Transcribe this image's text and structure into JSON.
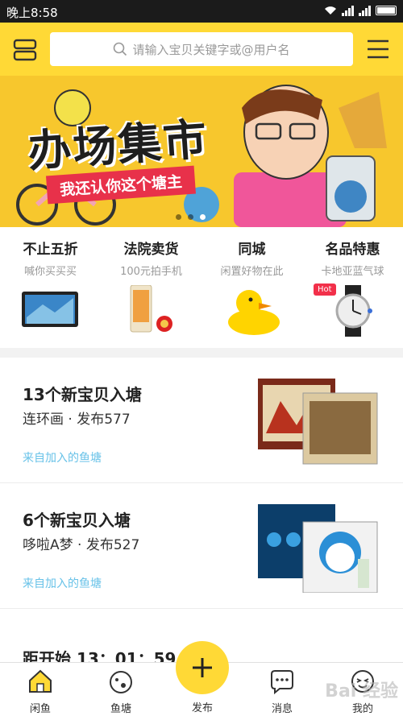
{
  "status": {
    "time": "晚上8:58"
  },
  "header": {
    "search_placeholder": "请输入宝贝关键字或@用户名"
  },
  "banner": {
    "title": "办场集市",
    "subtitle": "我还认你这个塘主"
  },
  "categories": [
    {
      "name": "不止五折",
      "desc": "喊你买买买",
      "icon": "tablet-icon"
    },
    {
      "name": "法院卖货",
      "desc": "100元拍手机",
      "icon": "phone-icon"
    },
    {
      "name": "同城",
      "desc": "闲置好物在此",
      "icon": "rubber-duck-icon"
    },
    {
      "name": "名品特惠",
      "desc": "卡地亚蓝气球",
      "icon": "watch-icon",
      "badge": "Hot"
    }
  ],
  "feed": [
    {
      "title": "13个新宝贝入塘",
      "meta_name": "连环画",
      "meta_count": "发布577",
      "source": "来自加入的鱼塘"
    },
    {
      "title": "6个新宝贝入塘",
      "meta_name": "哆啦A梦",
      "meta_count": "发布527",
      "source": "来自加入的鱼塘"
    },
    {
      "title": "距开始 13：01：59"
    }
  ],
  "tabs": [
    {
      "label": "闲鱼",
      "icon": "home-icon"
    },
    {
      "label": "鱼塘",
      "icon": "pond-icon"
    },
    {
      "label": "发布",
      "icon": "plus-icon"
    },
    {
      "label": "消息",
      "icon": "message-icon"
    },
    {
      "label": "我的",
      "icon": "profile-icon"
    }
  ],
  "watermark": "Bai 经验",
  "colors": {
    "brand_yellow": "#ffd936",
    "link_blue": "#68c2e8",
    "hot_red": "#f2304a"
  }
}
